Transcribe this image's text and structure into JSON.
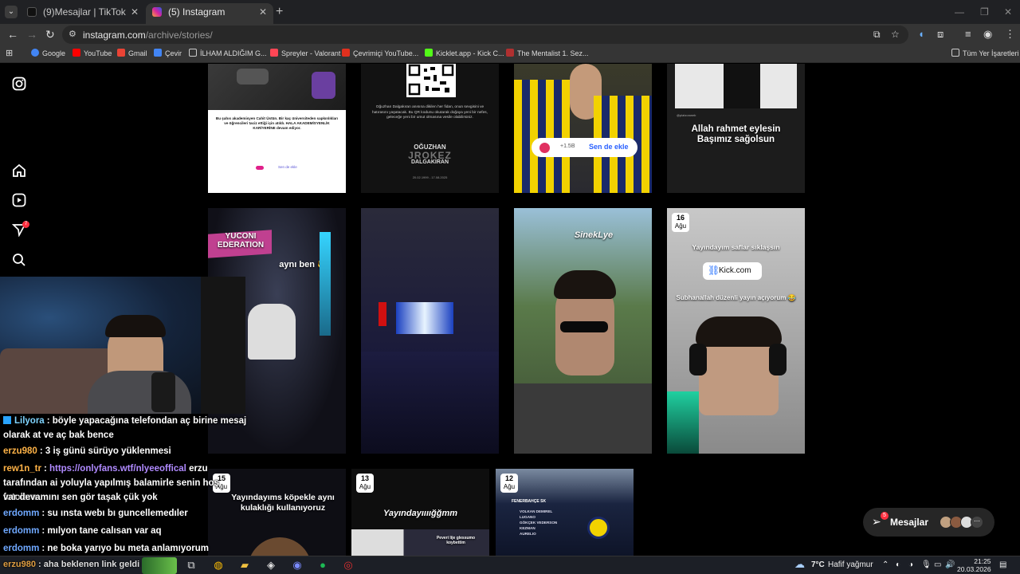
{
  "browser": {
    "tabs": [
      {
        "label": "(9)Mesajlar | TikTok"
      },
      {
        "label": "(5) Instagram"
      }
    ],
    "url_host": "instagram.com",
    "url_path": "/archive/stories/",
    "bookmarks": [
      {
        "label": "Google",
        "color": "#4285f4"
      },
      {
        "label": "YouTube",
        "color": "#ff0000"
      },
      {
        "label": "Gmail",
        "color": "#ea4335"
      },
      {
        "label": "Çevir",
        "color": "#4285f4"
      },
      {
        "label": "İLHAM ALDIĞIM G...",
        "color": "#999999"
      },
      {
        "label": "Spreyler - Valorant",
        "color": "#ff4655"
      },
      {
        "label": "Çevrimiçi YouTube...",
        "color": "#e0301e"
      },
      {
        "label": "Kicklet.app - Kick C...",
        "color": "#53fc18"
      },
      {
        "label": "The Mentalist 1. Sez...",
        "color": "#b03030"
      }
    ],
    "all_bookmarks_label": "Tüm Yer İşaretleri"
  },
  "sidebar": {
    "notifications_count": "7"
  },
  "stories": {
    "row1": [
      {
        "text": "Bu şahıs akademisyen Cahit Üstün. Bir kaç üniversiteden sapkınlıkları ve öğrencileri taciz ettiği için atıldı. HALA AKADEMİSYENLİK KARİYERİNE devam ediyor.",
        "link": "Sen de ekle"
      },
      {
        "text": "Oğuzhan Dalgakıran anısına dikilen her fidan, onun sevgisini ve hatırasını yaşatacak. Bu QR kodunu okutarak doğaya yeni bir nefes, geleceğe yeni bir umut olmasına vesile olabilirsiniz.",
        "name_top": "OĞUZHAN",
        "name_mid": "JROKEZ",
        "name_bot": "DALGAKIRAN",
        "dates": "20.02.1999 - 17.08.2025"
      },
      {
        "count": "+1.5B",
        "cta": "Sen de ekle"
      },
      {
        "handle": "@platzonweb",
        "text": "Allah rahmet eylesin Başımız sağolsun"
      }
    ],
    "row2": [
      {
        "text": "aynı ben 😎",
        "sign": "YUCONI EDERATION"
      },
      {},
      {
        "text": "SinekLye"
      },
      {
        "day": "16",
        "month": "Ağu",
        "text": "Yayındayım saflar sıklaşsın",
        "link": "Kick.com",
        "text2": "Subhanallah düzenli yayın açıyorum 😂"
      }
    ],
    "row3": [
      {
        "day": "15",
        "month": "Ağu",
        "text": "Yayındayıms köpekle aynı kulaklığı kullanıyoruz"
      },
      {
        "day": "13",
        "month": "Ağu",
        "text": "Yayındayıııığğmm",
        "sub": "Peveri lije glessumo koybettim"
      },
      {
        "day": "12",
        "month": "Ağu",
        "heading": "FENERBAHÇE SK",
        "players": [
          "VOLKAN DEMIREL",
          "LUGANO",
          "GÖKÇEK VEDERSON",
          "KEZMAN",
          "AURELIO"
        ]
      }
    ]
  },
  "messages": {
    "label": "Mesajlar",
    "badge": "5"
  },
  "chat": [
    {
      "user": "Lilyora",
      "color": "#7fd4ff",
      "text": "böyle yapacağına telefondan aç birine mesaj",
      "cont": "olarak at ve aç bak bence"
    },
    {
      "user": "erzu980",
      "color": "#ffb347",
      "text": "3 iş günü sürüyo yüklenmesi"
    },
    {
      "user": "rew1n_tr",
      "color": "#ffb347",
      "link": "https://onlyfans.wtf/nlyeeoffical",
      "text": "erzu",
      "cont": "tarafından ai yoluyla yapılmış balamirle senin hoş fotoların",
      "cont2": "var devamını sen gör taşak çük yok"
    },
    {
      "user": "erdomm",
      "color": "#6fa8ff",
      "text": "su ınsta webı bı guncellemedıler"
    },
    {
      "user": "erdomm",
      "color": "#6fa8ff",
      "text": "mılyon tane calısan var aq"
    },
    {
      "user": "erdomm",
      "color": "#6fa8ff",
      "text": "ne boka yarıyo bu meta anlamıyorum"
    },
    {
      "user": "erzu980",
      "color": "#ffb347",
      "text": "aha beklenen link geldi"
    }
  ],
  "taskbar": {
    "weather": "7°C",
    "weather_desc": "Hafif yağmur",
    "time": "21:25",
    "date": "20.03.2026"
  }
}
